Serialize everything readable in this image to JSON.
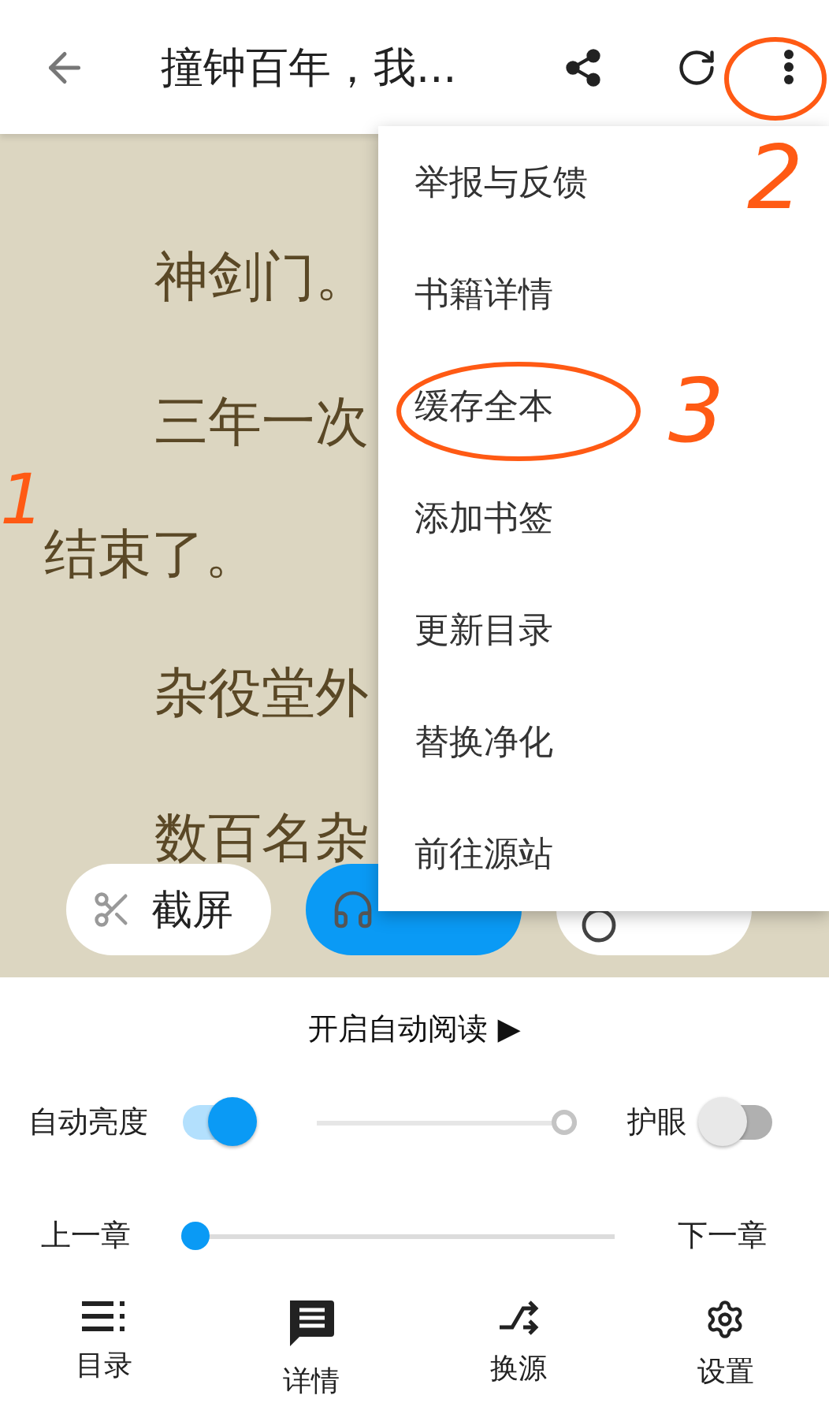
{
  "top_bar": {
    "title": "撞钟百年，我..."
  },
  "reader": {
    "lines": [
      {
        "kind": "indent",
        "text": "神剑门。"
      },
      {
        "kind": "indent",
        "text": "三年一次"
      },
      {
        "kind": "continue",
        "text": "结束了。"
      },
      {
        "kind": "indent",
        "text": "杂役堂外"
      },
      {
        "kind": "indent",
        "text": "数百名杂"
      }
    ]
  },
  "quick_buttons": [
    {
      "label": "截屏",
      "kind": "screenshot",
      "selected": false
    },
    {
      "kind": "listen",
      "selected": true
    },
    {
      "kind": "night",
      "selected": false
    }
  ],
  "menu": {
    "items": [
      "举报与反馈",
      "书籍详情",
      "缓存全本",
      "添加书签",
      "更新目录",
      "替换净化",
      "前往源站"
    ]
  },
  "auto_read": {
    "label": "开启自动阅读 ▶"
  },
  "brightness": {
    "auto_label": "自动亮度",
    "auto_on": true,
    "level": 1,
    "eye_label": "护眼",
    "eye_on": false
  },
  "chapter": {
    "prev": "上一章",
    "next": "下一章",
    "level": 0
  },
  "nav": [
    {
      "label": "目录",
      "kind": "toc"
    },
    {
      "label": "详情",
      "kind": "detail"
    },
    {
      "label": "换源",
      "kind": "source"
    },
    {
      "label": "设置",
      "kind": "settings"
    }
  ],
  "annotations": [
    {
      "kind": "circle"
    },
    {
      "kind": "number",
      "text": "2"
    },
    {
      "kind": "circle"
    },
    {
      "kind": "number",
      "text": "3"
    },
    {
      "kind": "number",
      "text": "1"
    }
  ]
}
